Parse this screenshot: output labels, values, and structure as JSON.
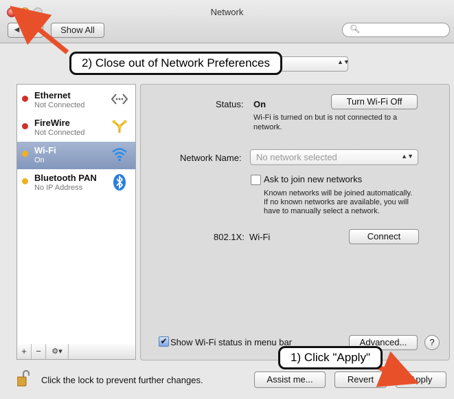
{
  "window": {
    "title": "Network"
  },
  "toolbar": {
    "show_all_label": "Show All",
    "search_placeholder": ""
  },
  "location": {
    "value": ""
  },
  "services": [
    {
      "name": "Ethernet",
      "status": "Not Connected",
      "dot_color": "#d0302a",
      "icon": "ethernet-icon"
    },
    {
      "name": "FireWire",
      "status": "Not Connected",
      "dot_color": "#d0302a",
      "icon": "firewire-icon"
    },
    {
      "name": "Wi-Fi",
      "status": "On",
      "dot_color": "#f0b020",
      "icon": "wifi-icon"
    },
    {
      "name": "Bluetooth PAN",
      "status": "No IP Address",
      "dot_color": "#f0b020",
      "icon": "bluetooth-icon"
    }
  ],
  "sidebar_tools": {
    "add": "+",
    "remove": "−",
    "gear": "⚙▾"
  },
  "detail": {
    "status_label": "Status:",
    "status_value": "On",
    "turn_off_button": "Turn Wi-Fi Off",
    "status_desc_line1": "Wi-Fi is turned on but is not connected to a",
    "status_desc_line2": "network.",
    "network_name_label": "Network Name:",
    "network_name_value": "No network selected",
    "ask_join_label": "Ask to join new networks",
    "ask_join_desc_line1": "Known networks will be joined automatically.",
    "ask_join_desc_line2": "If no known networks are available, you will",
    "ask_join_desc_line3": "have to manually select a network.",
    "dot1x_label": "802.1X:",
    "dot1x_value": "Wi-Fi",
    "connect_button": "Connect",
    "show_status_label": "Show Wi-Fi status in menu bar",
    "advanced_button": "Advanced...",
    "help_button": "?"
  },
  "bottom": {
    "lock_text": "Click the lock to prevent further changes.",
    "assist_button": "Assist me...",
    "revert_button": "Revert",
    "apply_button": "Apply"
  },
  "annotations": {
    "step2": "2) Close out of Network Preferences",
    "step1": "1) Click \"Apply\"",
    "arrow_color": "#e8502a"
  }
}
